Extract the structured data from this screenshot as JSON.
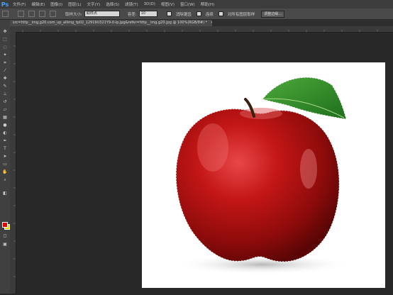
{
  "app": {
    "logo": "Ps"
  },
  "menu": [
    "文件(F)",
    "编辑(E)",
    "图像(I)",
    "图层(L)",
    "文字(Y)",
    "选择(S)",
    "滤镜(T)",
    "3D(D)",
    "视图(V)",
    "窗口(W)",
    "帮助(H)"
  ],
  "options": {
    "sample_size_label": "取样大小:",
    "sample_size_value": "取样点",
    "tolerance_label": "容差:",
    "tolerance_value": "10",
    "antialias_label": "消除锯齿",
    "contiguous_label": "连续",
    "sample_all_label": "对所有图层取样",
    "refine_edge_label": "调整边缘..."
  },
  "document": {
    "tab_title": "src=http__img.g20.com_up_allimg_tp02_12919U321Y9-0-lp.jpg&refer=http__img.g20.jpg @ 100%(RGB/8#) *",
    "close_glyph": "×"
  },
  "colors": {
    "foreground": "#e00000",
    "background": "#f5d000",
    "accent": "#4aa3ff"
  },
  "icons": [
    "move-icon",
    "marquee-icon",
    "lasso-icon",
    "magic-wand-icon",
    "crop-icon",
    "eyedropper-icon",
    "healing-brush-icon",
    "brush-icon",
    "clone-stamp-icon",
    "history-brush-icon",
    "eraser-icon",
    "gradient-icon",
    "blur-icon",
    "dodge-icon",
    "pen-icon",
    "type-icon",
    "path-selection-icon",
    "shape-icon",
    "hand-icon",
    "zoom-icon"
  ]
}
